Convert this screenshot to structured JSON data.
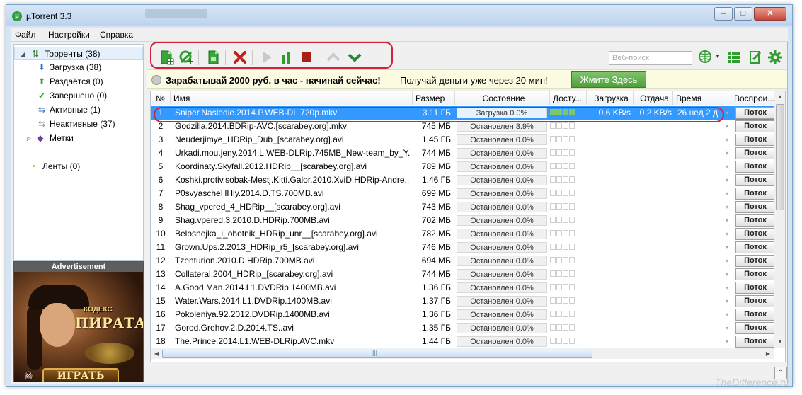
{
  "window": {
    "title": "µTorrent 3.3",
    "controls": {
      "minimize": "–",
      "maximize": "□",
      "close": "✕"
    }
  },
  "menu": [
    "Файл",
    "Настройки",
    "Справка"
  ],
  "sidebar": {
    "categories": [
      {
        "label": "Торренты (38)",
        "icon": "torrents-icon",
        "expanded": true
      },
      {
        "label": "Загрузка (38)",
        "icon": "download-arrow-icon"
      },
      {
        "label": "Раздаётся (0)",
        "icon": "upload-arrow-icon"
      },
      {
        "label": "Завершено (0)",
        "icon": "checkmark-icon"
      },
      {
        "label": "Активные (1)",
        "icon": "active-arrows-icon"
      },
      {
        "label": "Неактивные (37)",
        "icon": "inactive-arrows-icon"
      },
      {
        "label": "Метки",
        "icon": "tag-icon"
      },
      {
        "label": "Ленты (0)",
        "icon": "rss-feed-icon"
      }
    ],
    "ad": {
      "header": "Advertisement",
      "brand_top": "КОДЕКС",
      "brand_main": "ПИРАТА",
      "play_label": "ИГРАТЬ"
    }
  },
  "toolbar": {
    "search_placeholder": "Веб-поиск",
    "icons": [
      "add-torrent-icon",
      "add-url-icon",
      "create-torrent-icon",
      "remove-icon",
      "start-icon",
      "pause-icon",
      "stop-icon",
      "move-up-icon",
      "move-down-icon",
      "search-globe-icon",
      "list-view-icon",
      "remote-icon",
      "settings-icon"
    ]
  },
  "promo": {
    "bold_text": "Зарабатывай 2000 руб. в час - начинай сейчас!",
    "text": "Получай деньги уже через 20 мин!",
    "button": "Жмите Здесь"
  },
  "table": {
    "columns": {
      "num": "№",
      "name": "Имя",
      "size": "Размер",
      "state": "Состояние",
      "avail": "Досту...",
      "down": "Загрузка",
      "up": "Отдача",
      "eta": "Время",
      "play": "Воспрои..."
    },
    "play_label": "Поток",
    "rows": [
      {
        "num": "1",
        "name": "Sniper.Nasledie.2014.P.WEB-DL.720p.mkv",
        "size": "3.11 ГБ",
        "state": "Загрузка 0.0%",
        "progress": 0.0,
        "avail_blocks": 4,
        "down": "0.6 KB/s",
        "up": "0.2 KB/s",
        "eta": "26 нед 2 д",
        "selected": true
      },
      {
        "num": "2",
        "name": "Godzilla.2014.BDRip-AVC.[scarabey.org].mkv",
        "size": "745 МБ",
        "state": "Остановлен 3.9%",
        "progress": 0.039
      },
      {
        "num": "3",
        "name": "Neuderjimye_HDRip_Dub_[scarabey.org].avi",
        "size": "1.45 ГБ",
        "state": "Остановлен 0.0%",
        "progress": 0.0
      },
      {
        "num": "4",
        "name": "Urkadi.mou.jeny.2014.L.WEB-DLRip.745MB_New-team_by_Y...",
        "size": "744 МБ",
        "state": "Остановлен 0.0%",
        "progress": 0.0
      },
      {
        "num": "5",
        "name": "Koordinaty.Skyfall.2012.HDRip__[scarabey.org].avi",
        "size": "789 МБ",
        "state": "Остановлен 0.0%",
        "progress": 0.0
      },
      {
        "num": "6",
        "name": "Koshki.protiv.sobak-Mestj.Kitti.Galor.2010.XviD.HDRip-Andre...",
        "size": "1.46 ГБ",
        "state": "Остановлен 0.0%",
        "progress": 0.0
      },
      {
        "num": "7",
        "name": "P0svyascheHHiy.2014.D.TS.700MB.avi",
        "size": "699 МБ",
        "state": "Остановлен 0.0%",
        "progress": 0.0
      },
      {
        "num": "8",
        "name": "Shag_vpered_4_HDRip__[scarabey.org].avi",
        "size": "743 МБ",
        "state": "Остановлен 0.0%",
        "progress": 0.0
      },
      {
        "num": "9",
        "name": "Shag.vpered.3.2010.D.HDRip.700MB.avi",
        "size": "702 МБ",
        "state": "Остановлен 0.0%",
        "progress": 0.0
      },
      {
        "num": "10",
        "name": "Belosnejka_i_ohotnik_HDRip_unr__[scarabey.org].avi",
        "size": "782 МБ",
        "state": "Остановлен 0.0%",
        "progress": 0.0
      },
      {
        "num": "11",
        "name": "Grown.Ups.2.2013_HDRip_r5_[scarabey.org].avi",
        "size": "746 МБ",
        "state": "Остановлен 0.0%",
        "progress": 0.0
      },
      {
        "num": "12",
        "name": "Tzenturion.2010.D.HDRip.700MB.avi",
        "size": "694 МБ",
        "state": "Остановлен 0.0%",
        "progress": 0.0
      },
      {
        "num": "13",
        "name": "Collateral.2004_HDRip_[scarabey.org].avi",
        "size": "744 МБ",
        "state": "Остановлен 0.0%",
        "progress": 0.0
      },
      {
        "num": "14",
        "name": "A.Good.Man.2014.L1.DVDRip.1400MB.avi",
        "size": "1.36 ГБ",
        "state": "Остановлен 0.0%",
        "progress": 0.0
      },
      {
        "num": "15",
        "name": "Water.Wars.2014.L1.DVDRip.1400MB.avi",
        "size": "1.37 ГБ",
        "state": "Остановлен 0.0%",
        "progress": 0.0
      },
      {
        "num": "16",
        "name": "Pokoleniya.92.2012.DVDRip.1400MB.avi",
        "size": "1.36 ГБ",
        "state": "Остановлен 0.0%",
        "progress": 0.0
      },
      {
        "num": "17",
        "name": "Gorod.Grehov.2.D.2014.TS..avi",
        "size": "1.35 ГБ",
        "state": "Остановлен 0.0%",
        "progress": 0.0
      },
      {
        "num": "18",
        "name": "The.Prince.2014.L1.WEB-DLRip.AVC.mkv",
        "size": "1.44 ГБ",
        "state": "Остановлен 0.0%",
        "progress": 0.0
      }
    ]
  },
  "watermark": "TheDifference.ru",
  "colors": {
    "selection": "#3399ff",
    "highlight": "#d4203a",
    "accent_green": "#2e9e3c"
  }
}
